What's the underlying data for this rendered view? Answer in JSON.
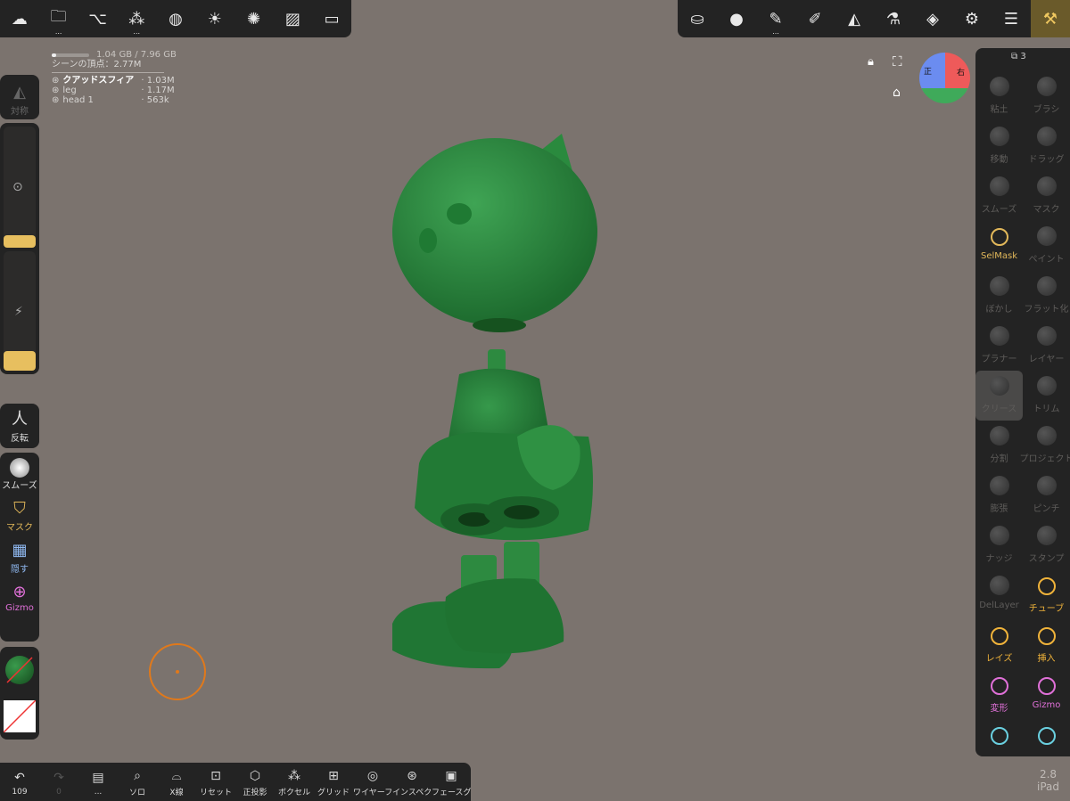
{
  "top_left_toolbar": [
    {
      "icon": "nomad-logo-icon"
    },
    {
      "icon": "folder-icon",
      "sub": "..."
    },
    {
      "icon": "scene-graph-icon"
    },
    {
      "icon": "primitives-icon",
      "sub": "..."
    },
    {
      "icon": "material-sphere-icon"
    },
    {
      "icon": "light-sun-icon"
    },
    {
      "icon": "postprocess-aperture-icon"
    },
    {
      "icon": "background-image-icon"
    },
    {
      "icon": "camera-video-icon"
    }
  ],
  "top_right_toolbar": [
    {
      "icon": "stroke-settings-icon"
    },
    {
      "icon": "matcap-sphere-icon"
    },
    {
      "icon": "pen-icon",
      "sub": "..."
    },
    {
      "icon": "paint-brush-icon"
    },
    {
      "icon": "symmetry-icon"
    },
    {
      "icon": "flask-icon"
    },
    {
      "icon": "layers-icon"
    },
    {
      "icon": "settings-gear-icon"
    },
    {
      "icon": "sliders-icon"
    },
    {
      "icon": "tools-menu-icon"
    }
  ],
  "stats": {
    "memory": "1.04 GB / 7.96 GB",
    "memory_fraction": 0.13,
    "scene_vertices": "シーンの頂点：2.77M",
    "objects": [
      {
        "name": "クアッドスフィア",
        "count": "· 1.03M",
        "selected": true
      },
      {
        "name": "leg",
        "count": "· 1.17M",
        "selected": false
      },
      {
        "name": "head 1",
        "count": "· 563k",
        "selected": false
      }
    ]
  },
  "left_panel": {
    "symmetry_label": "対称",
    "radius_value": 0.06,
    "intensity_value": 0.06,
    "invert_label": "反転",
    "smooth_label": "スムーズ",
    "mask_label": "マスク",
    "hide_label": "隠す",
    "gizmo_label": "Gizmo"
  },
  "viewport": {
    "lock": "lock-icon",
    "fullscreen": "fullscreen-icon",
    "home": "home-icon",
    "cube_front": "正",
    "cube_right": "右"
  },
  "right_panel": {
    "counter": "3",
    "tools": [
      {
        "label": "粘土",
        "active": false
      },
      {
        "label": "ブラシ",
        "active": false
      },
      {
        "label": "移動",
        "active": false
      },
      {
        "label": "ドラッグ",
        "active": false
      },
      {
        "label": "スムーズ",
        "active": false
      },
      {
        "label": "マスク",
        "active": false
      },
      {
        "label": "SelMask",
        "active": true,
        "color": "#e2b85a"
      },
      {
        "label": "ペイント",
        "active": false
      },
      {
        "label": "ぼかし",
        "active": false
      },
      {
        "label": "フラット化",
        "active": false
      },
      {
        "label": "プラナー",
        "active": false
      },
      {
        "label": "レイヤー",
        "active": false
      },
      {
        "label": "クリース",
        "active": false,
        "selected": true
      },
      {
        "label": "トリム",
        "active": false
      },
      {
        "label": "分割",
        "active": false
      },
      {
        "label": "プロジェクト",
        "active": false
      },
      {
        "label": "膨張",
        "active": false
      },
      {
        "label": "ピンチ",
        "active": false
      },
      {
        "label": "ナッジ",
        "active": false
      },
      {
        "label": "スタンプ",
        "active": false
      },
      {
        "label": "DelLayer",
        "active": false
      },
      {
        "label": "チューブ",
        "active": true,
        "color": "#f0b33a"
      },
      {
        "label": "レイズ",
        "active": true,
        "color": "#f0b33a"
      },
      {
        "label": "挿入",
        "active": true,
        "color": "#f0b33a"
      },
      {
        "label": "変形",
        "active": true,
        "color": "#e070d8"
      },
      {
        "label": "Gizmo",
        "active": true,
        "color": "#e070d8"
      },
      {
        "label": "",
        "icon": "ruler-icon",
        "active": true,
        "color": "#6ad0e0"
      },
      {
        "label": "",
        "icon": "camera-icon",
        "active": true,
        "color": "#6ad0e0"
      }
    ]
  },
  "bottom_toolbar": [
    {
      "icon": "undo-icon",
      "label": "109"
    },
    {
      "icon": "redo-icon",
      "label": "0"
    },
    {
      "icon": "history-icon",
      "label": "..."
    },
    {
      "icon": "solo-search-icon",
      "label": "ソロ"
    },
    {
      "icon": "xray-glasses-icon",
      "label": "X線"
    },
    {
      "icon": "reset-camera-icon",
      "label": "リセット"
    },
    {
      "icon": "ortho-cube-icon",
      "label": "正投影"
    },
    {
      "icon": "voxel-icon",
      "label": "ボクセル"
    },
    {
      "icon": "grid-icon",
      "label": "グリッド"
    },
    {
      "icon": "wireframe-icon",
      "label": "ワイヤーフレーム"
    },
    {
      "icon": "inspector-icon",
      "label": "インスペクター"
    },
    {
      "icon": "facegroup-icon",
      "label": "フェースグループ"
    }
  ],
  "version": {
    "number": "2.8",
    "device": "iPad"
  }
}
